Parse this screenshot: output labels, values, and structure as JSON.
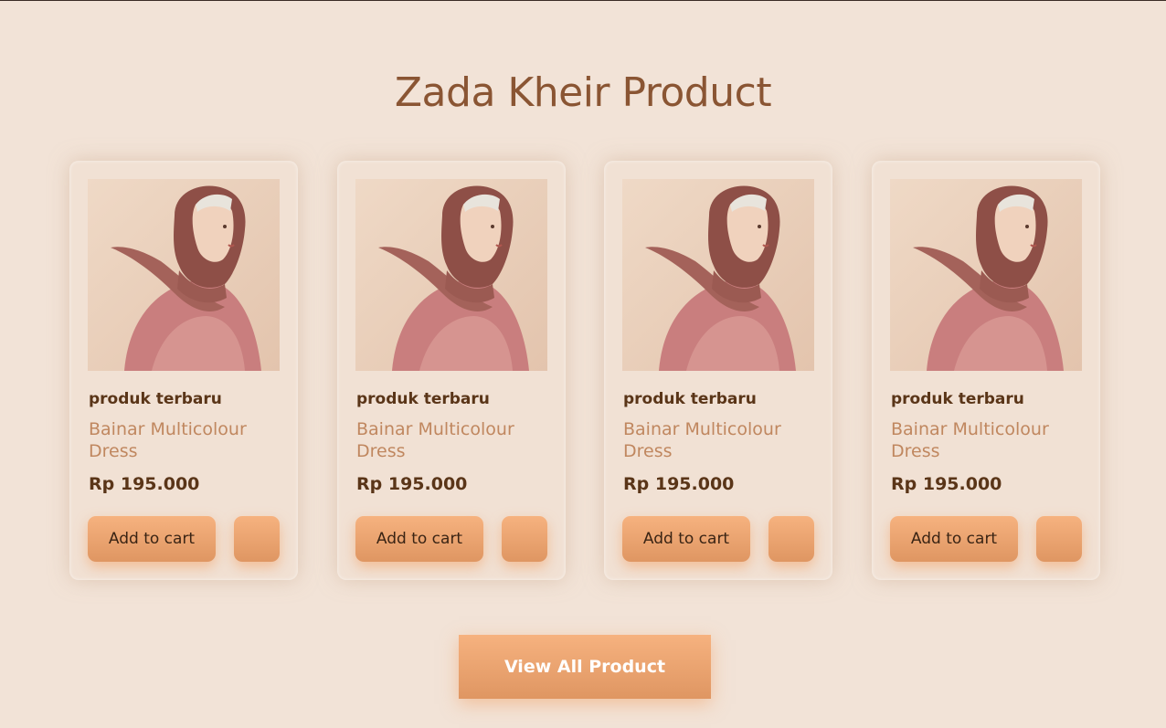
{
  "section": {
    "title": "Zada Kheir Product",
    "view_all_label": "View All Product"
  },
  "products": [
    {
      "badge": "produk terbaru",
      "name": "Bainar Multicolour Dress",
      "price": "Rp 195.000",
      "add_to_cart_label": "Add to cart",
      "image_icon": "hijab-model-photo"
    },
    {
      "badge": "produk terbaru",
      "name": "Bainar Multicolour Dress",
      "price": "Rp 195.000",
      "add_to_cart_label": "Add to cart",
      "image_icon": "hijab-model-photo"
    },
    {
      "badge": "produk terbaru",
      "name": "Bainar Multicolour Dress",
      "price": "Rp 195.000",
      "add_to_cart_label": "Add to cart",
      "image_icon": "hijab-model-photo"
    },
    {
      "badge": "produk terbaru",
      "name": "Bainar Multicolour Dress",
      "price": "Rp 195.000",
      "add_to_cart_label": "Add to cart",
      "image_icon": "hijab-model-photo"
    }
  ],
  "colors": {
    "background": "#f2e3d7",
    "title": "#8a5533",
    "product_name": "#c0875f",
    "button_gradient_top": "#f6b27f",
    "button_gradient_bottom": "#df9662"
  }
}
